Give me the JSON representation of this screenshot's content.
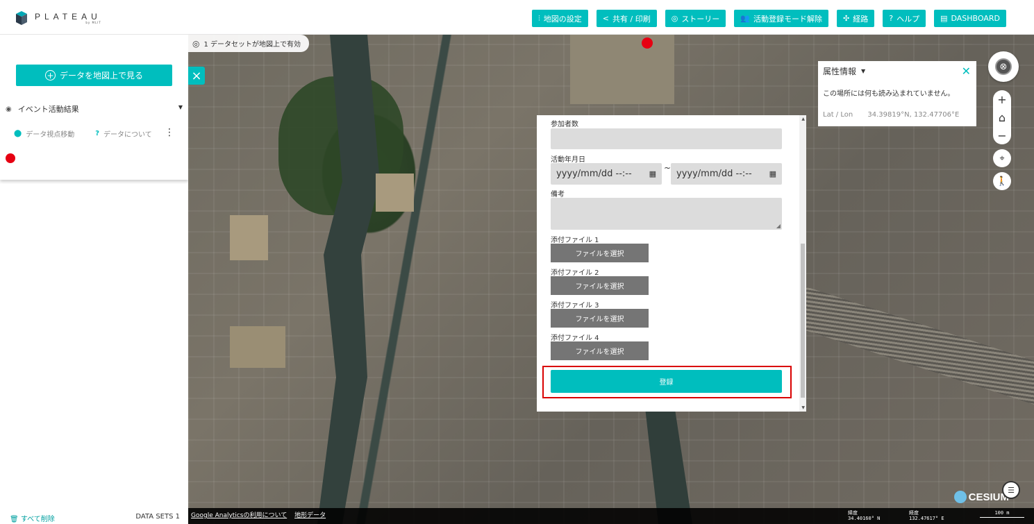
{
  "header": {
    "logo_main": "PLATEAU",
    "logo_sub": "by MLIT",
    "nav": [
      {
        "icon": "⫶",
        "icon_name": "sliders-icon",
        "label": "地図の設定"
      },
      {
        "icon": "<",
        "icon_name": "share-icon",
        "label": "共有 / 印刷"
      },
      {
        "icon": "◎",
        "icon_name": "story-icon",
        "label": "ストーリー"
      },
      {
        "icon": "👥",
        "icon_name": "group-icon",
        "label": "活動登録モード解除"
      },
      {
        "icon": "✣",
        "icon_name": "route-icon",
        "label": "経路"
      },
      {
        "icon": "?",
        "icon_name": "help-icon",
        "label": "ヘルプ"
      },
      {
        "icon": "▤",
        "icon_name": "book-icon",
        "label": "DASHBOARD"
      }
    ]
  },
  "sidebar": {
    "view_button_label": "データを地図上で見る",
    "dataset": {
      "title": "イベント活動結果",
      "move_label": "データ視点移動",
      "about_label": "データについて"
    },
    "footer": {
      "clear_label": "すべて削除",
      "count_label": "DATA SETS 1"
    }
  },
  "map": {
    "badge_text": "1 データセットが地図上で有効",
    "attr": {
      "title": "属性情報",
      "message": "この場所には何も読み込まれていません。",
      "latlon_label": "Lat / Lon",
      "latlon_value": "34.39819°N, 132.47706°E"
    },
    "bottom": {
      "link1": "Google Analyticsの利用について",
      "link2": "地形データ",
      "lat_label": "緯度",
      "lat_value": "34.40160° N",
      "lon_label": "経度",
      "lon_value": "132.47617° E",
      "scale": "100 m"
    },
    "cesium_label": "CESIUM"
  },
  "form": {
    "participants_label": "参加者数",
    "date_label": "活動年月日",
    "date_placeholder": "yyyy/mm/dd --:--",
    "date_sep": "~",
    "note_label": "備考",
    "file1_label": "添付ファイル 1",
    "file2_label": "添付ファイル 2",
    "file3_label": "添付ファイル 3",
    "file4_label": "添付ファイル 4",
    "file_button_label": "ファイルを選択",
    "submit_label": "登録"
  },
  "colors": {
    "accent": "#00bebe",
    "marker": "#e60012",
    "highlight": "#d90000"
  }
}
